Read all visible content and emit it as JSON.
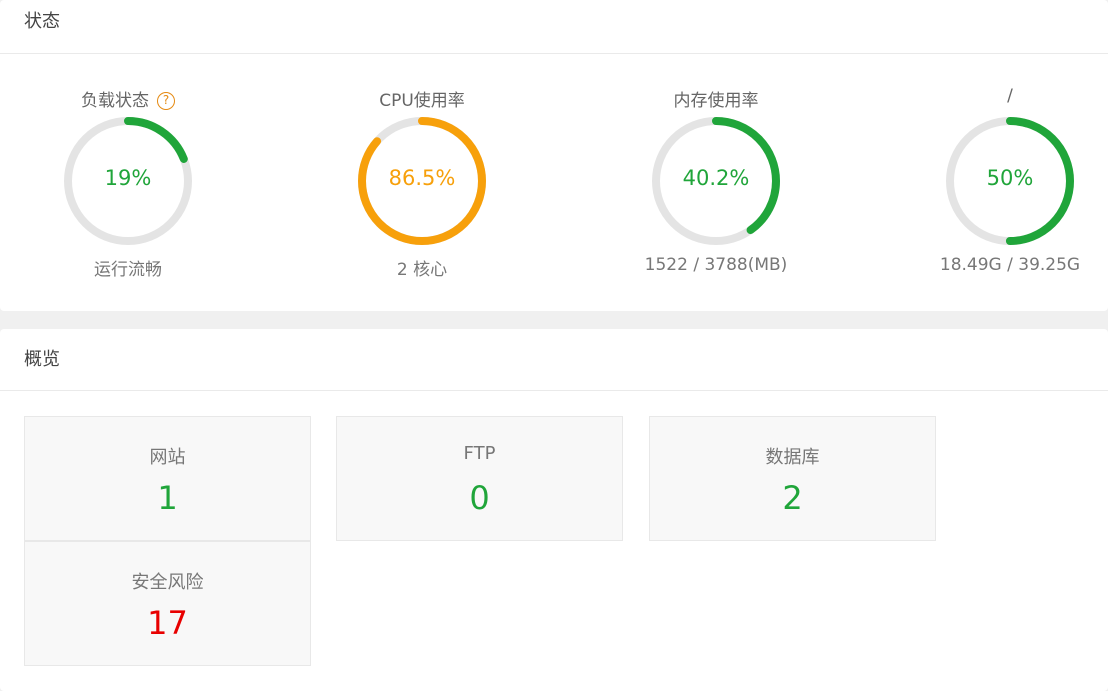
{
  "status": {
    "title": "状态",
    "gauges": [
      {
        "title": "负载状态",
        "value": "19%",
        "percent": 19,
        "sub": "运行流畅",
        "color": "#20a53a",
        "help_icon": "question-circle-icon"
      },
      {
        "title": "CPU使用率",
        "value": "86.5%",
        "percent": 86.5,
        "sub": "2 核心",
        "color": "#f7a00b"
      },
      {
        "title": "内存使用率",
        "value": "40.2%",
        "percent": 40.2,
        "sub": "1522 / 3788(MB)",
        "color": "#20a53a"
      },
      {
        "title": "/",
        "value": "50%",
        "percent": 50,
        "sub": "18.49G / 39.25G",
        "color": "#20a53a"
      }
    ],
    "track_color": "#e4e4e4",
    "help_mark": "?"
  },
  "overview": {
    "title": "概览",
    "tiles": [
      {
        "label": "网站",
        "count": "1"
      },
      {
        "label": "FTP",
        "count": "0"
      },
      {
        "label": "数据库",
        "count": "2"
      },
      {
        "label": "安全风险",
        "count": "17",
        "color": "#e80000"
      }
    ],
    "count_color": "#20a53a"
  }
}
